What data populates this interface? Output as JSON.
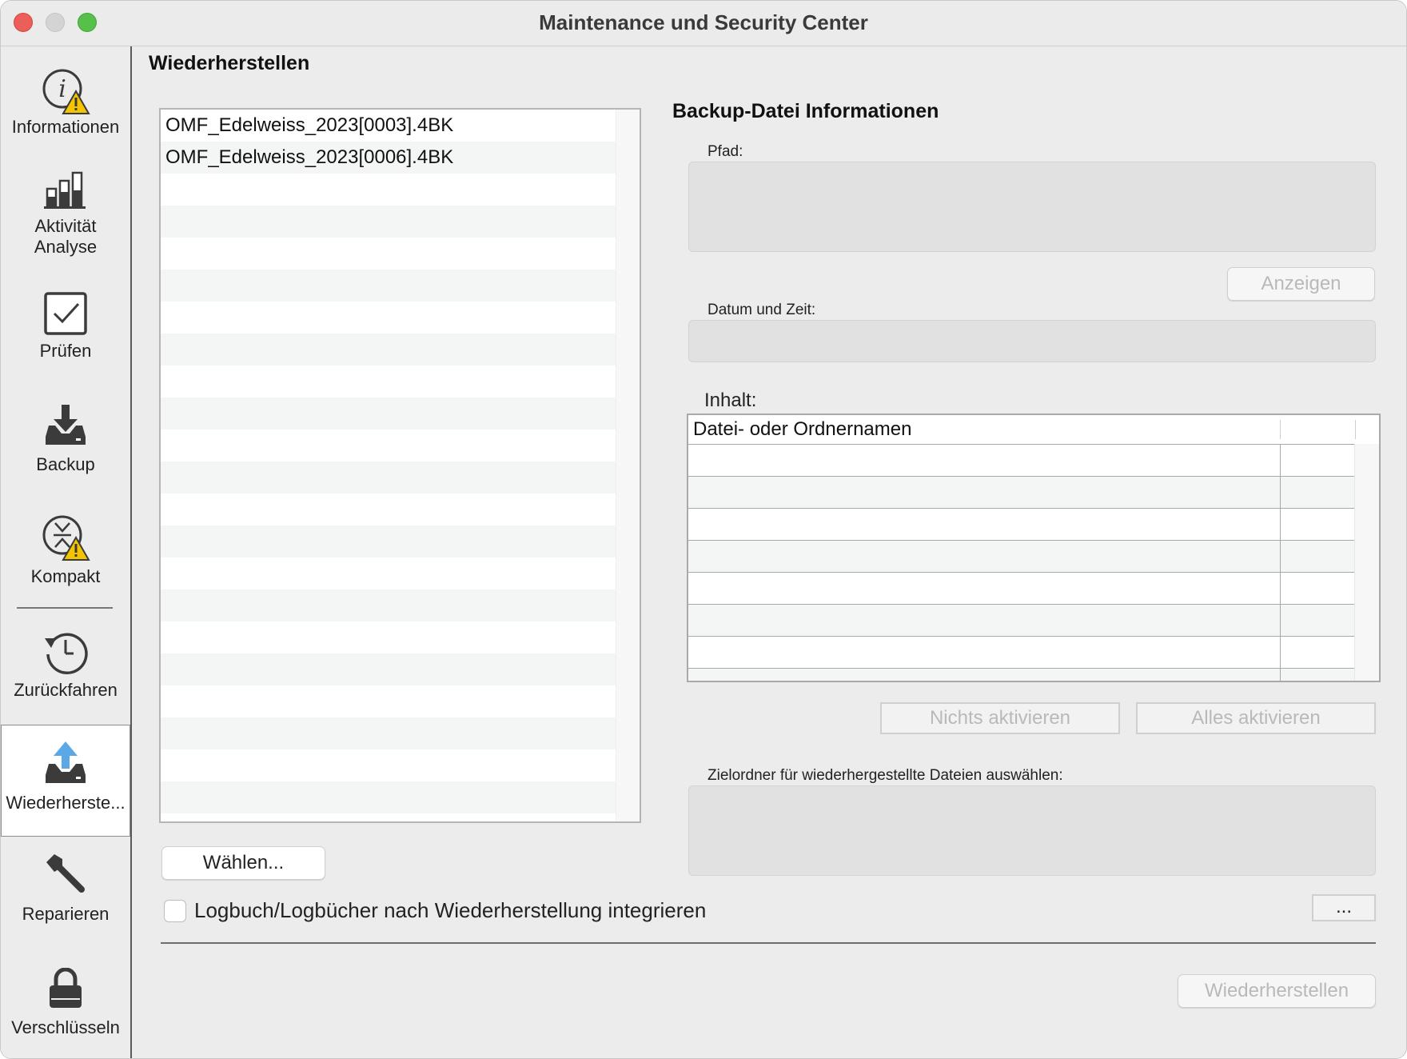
{
  "window": {
    "title": "Maintenance und Security Center"
  },
  "sidebar": {
    "items": [
      {
        "label": "Informationen",
        "icon": "info-warning-icon"
      },
      {
        "label_line1": "Aktivität",
        "label_line2": "Analyse",
        "icon": "bar-chart-icon"
      },
      {
        "label": "Prüfen",
        "icon": "checkbox-icon"
      },
      {
        "label": "Backup",
        "icon": "download-tray-icon"
      },
      {
        "label": "Kompakt",
        "icon": "compact-warning-icon"
      },
      {
        "label": "Zurückfahren",
        "icon": "rollback-clock-icon"
      },
      {
        "label": "Wiederherste...",
        "icon": "upload-tray-icon",
        "active": true
      },
      {
        "label": "Reparieren",
        "icon": "wrench-icon"
      },
      {
        "label": "Verschlüsseln",
        "icon": "lock-icon"
      }
    ]
  },
  "main": {
    "title": "Wiederherstellen",
    "files": [
      "OMF_Edelweiss_2023[0003].4BK",
      "OMF_Edelweiss_2023[0006].4BK"
    ],
    "choose_button": "Wählen...",
    "integrate_checkbox": {
      "label": "Logbuch/Logbücher nach Wiederherstellung integrieren",
      "checked": false
    },
    "more_button": "...",
    "restore_button": "Wiederherstellen"
  },
  "info": {
    "title": "Backup-Datei Informationen",
    "path_label": "Pfad:",
    "path_value": "",
    "show_button": "Anzeigen",
    "datetime_label": "Datum und Zeit:",
    "datetime_value": "",
    "content_label": "Inhalt:",
    "content_column": "Datei- oder Ordnernamen",
    "deselect_all_button": "Nichts aktivieren",
    "select_all_button": "Alles aktivieren",
    "target_label": "Zielordner für wiederhergestellte Dateien auswählen:",
    "target_value": ""
  },
  "colors": {
    "accent_blue": "#5aa9e6",
    "warning_yellow": "#f5c400",
    "icon_dark": "#3b3b3b"
  }
}
